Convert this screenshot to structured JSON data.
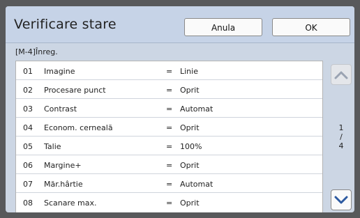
{
  "header": {
    "title": "Verificare stare",
    "cancel_label": "Anula",
    "ok_label": "OK"
  },
  "section_label": "[M-4]Înreg.",
  "rows": [
    {
      "num": "01",
      "name": "Imagine",
      "eq": "=",
      "value": "Linie"
    },
    {
      "num": "02",
      "name": "Procesare punct",
      "eq": "=",
      "value": "Oprit"
    },
    {
      "num": "03",
      "name": "Contrast",
      "eq": "=",
      "value": "Automat"
    },
    {
      "num": "04",
      "name": "Econom. cerneală",
      "eq": "=",
      "value": "Oprit"
    },
    {
      "num": "05",
      "name": "Talie",
      "eq": "=",
      "value": "100%"
    },
    {
      "num": "06",
      "name": "Margine+",
      "eq": "=",
      "value": "Oprit"
    },
    {
      "num": "07",
      "name": "Măr.hârtie",
      "eq": "=",
      "value": "Automat"
    },
    {
      "num": "08",
      "name": "Scanare max.",
      "eq": "=",
      "value": "Oprit"
    }
  ],
  "pagination": {
    "current": "1",
    "separator": "/",
    "total": "4",
    "up_icon": "chevron-up-icon",
    "down_icon": "chevron-down-icon"
  },
  "colors": {
    "panel_bg": "#ccd6e4",
    "header_bg": "#c6d3e7",
    "chevron_active": "#2d5aa0",
    "chevron_disabled": "#9aa3b2"
  }
}
